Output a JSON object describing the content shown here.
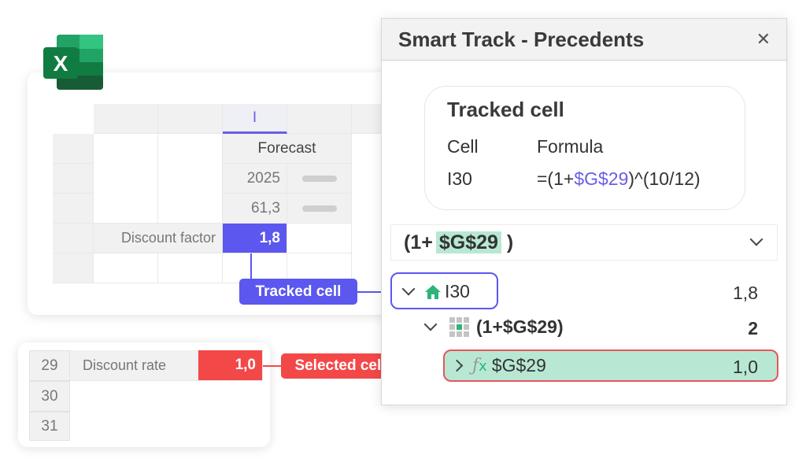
{
  "app": {
    "icon": "excel-icon",
    "logo_letter": "X"
  },
  "sheet": {
    "column_header": "I",
    "header_label": "Forecast",
    "year": "2025",
    "value_row": "61,3",
    "discount_factor_label": "Discount factor",
    "discount_factor_value": "1,8"
  },
  "small_sheet": {
    "rows": [
      {
        "row": "29",
        "label": "Discount rate",
        "value": "1,0"
      },
      {
        "row": "30",
        "label": "",
        "value": ""
      },
      {
        "row": "31",
        "label": "",
        "value": ""
      }
    ]
  },
  "callouts": {
    "tracked": "Tracked cell",
    "selected": "Selected cell",
    "tracked_color": "#5b57ef",
    "selected_color": "#f34848"
  },
  "panel": {
    "title": "Smart Track - Precedents",
    "close_icon": "close-icon",
    "tracked_card": {
      "title": "Tracked cell",
      "cell_label": "Cell",
      "formula_label": "Formula",
      "cell_value": "I30",
      "formula_prefix": "=(1+",
      "formula_ref": "$G$29",
      "formula_suffix": ")^(10/12)"
    },
    "formula_bar": {
      "prefix": "(1+",
      "ref": "$G$29",
      "suffix": ")"
    },
    "tree": [
      {
        "icon": "home-icon",
        "label": "I30",
        "value": "1,8",
        "expanded": true
      },
      {
        "icon": "grid-icon",
        "label": "(1+$G$29)",
        "value": "2",
        "expanded": true
      },
      {
        "icon": "fx-icon",
        "label": "$G$29",
        "value": "1,0",
        "expanded": false,
        "selected": true
      }
    ]
  },
  "colors": {
    "accent_purple": "#5b57ef",
    "accent_red": "#f34848",
    "highlight_green": "#b8e8d3",
    "excel_green": "#1e7145"
  }
}
